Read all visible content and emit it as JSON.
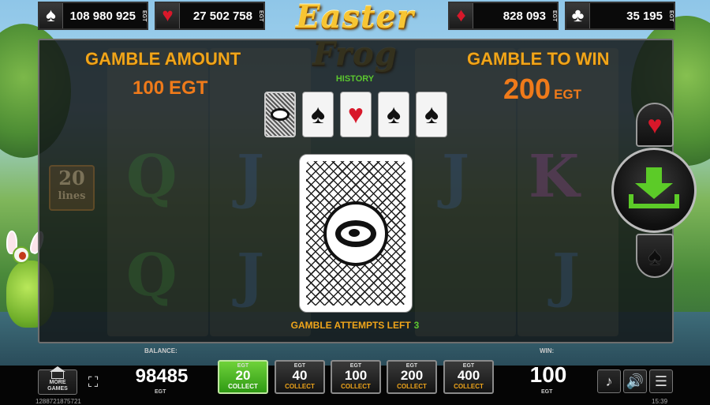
{
  "jackpots": [
    {
      "suit": "spade",
      "suit_icon": "♠",
      "value": "108 980 925",
      "unit": "EGT",
      "color": "#ffffff"
    },
    {
      "suit": "heart",
      "suit_icon": "♥",
      "value": "27 502 758",
      "unit": "EGT",
      "color": "#d8182a"
    },
    {
      "suit": "diamond",
      "suit_icon": "♦",
      "value": "828 093",
      "unit": "EGT",
      "color": "#d8182a"
    },
    {
      "suit": "club",
      "suit_icon": "♣",
      "value": "35 195",
      "unit": "EGT",
      "color": "#ffffff"
    }
  ],
  "logo": "Easter Frog",
  "gamble": {
    "amount_label": "GAMBLE AMOUNT",
    "amount_value": "100",
    "amount_unit": "EGT",
    "to_win_label": "GAMBLE TO WIN",
    "to_win_value": "200",
    "to_win_unit": "EGT",
    "history_label": "HISTORY",
    "history": [
      {
        "type": "back"
      },
      {
        "type": "spade",
        "icon": "♠"
      },
      {
        "type": "heart",
        "icon": "♥"
      },
      {
        "type": "spade",
        "icon": "♠"
      },
      {
        "type": "spade",
        "icon": "♠"
      }
    ],
    "attempts_label": "GAMBLE ATTEMPTS LEFT",
    "attempts_value": "3",
    "red_icon": "♥",
    "black_icon": "♠"
  },
  "background": {
    "lines_sign": "20",
    "lines_word": "lines",
    "ghost_letters": [
      "Q",
      "J",
      "J",
      "K",
      "Q",
      "J",
      "J"
    ]
  },
  "bottom": {
    "more_games": "MORE GAMES",
    "balance_label": "BALANCE:",
    "balance_value": "98485",
    "balance_unit": "EGT",
    "bets": [
      {
        "unit": "EGT",
        "amount": "20",
        "action": "COLLECT",
        "active": true
      },
      {
        "unit": "EGT",
        "amount": "40",
        "action": "COLLECT",
        "active": false
      },
      {
        "unit": "EGT",
        "amount": "100",
        "action": "COLLECT",
        "active": false
      },
      {
        "unit": "EGT",
        "amount": "200",
        "action": "COLLECT",
        "active": false
      },
      {
        "unit": "EGT",
        "amount": "400",
        "action": "COLLECT",
        "active": false
      }
    ],
    "win_label": "WIN:",
    "win_value": "100",
    "win_unit": "EGT",
    "footer_id": "1288721875721",
    "footer_time": "15:39"
  },
  "colors": {
    "gold": "#f0a51a",
    "orange": "#ef7a1a",
    "green": "#5ccb28",
    "red": "#d8182a"
  }
}
